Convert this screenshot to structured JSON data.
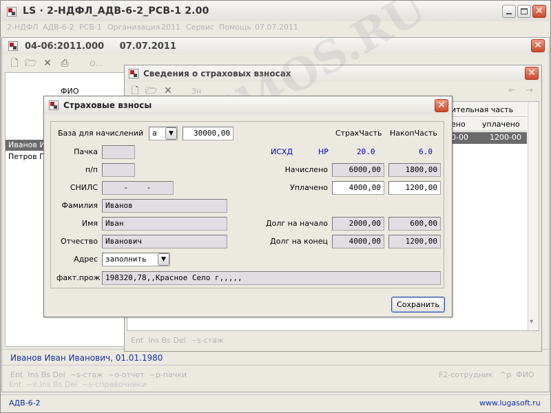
{
  "app": {
    "title": "LS · 2-НДФЛ_АДВ-6-2_РСВ-1  2.00",
    "menu": [
      "2-НДФЛ",
      "АДВ-6-2",
      "РСВ-1",
      "Организация",
      "2011",
      "Сервис",
      "Помощь",
      "07.07.2011"
    ]
  },
  "doc_window": {
    "title": "04-06:2011.000     07.07.2011",
    "toolbar_extra": "О...",
    "list_header": "ФИО",
    "rows": [
      "Иванов И",
      "Петров П"
    ],
    "footer_person": "Иванов Иван Иванович, 01.01.1980",
    "hotkeys_left": "Ent  Ins Bs Del  ~s-стаж  ~o-отчет  ~p-пачки",
    "hotkeys_right": "F2-сотрудник   ^p  ФИО",
    "ghost_hotkeys": "Ent  ~e.Ins Bs Del  ~s-справочники"
  },
  "ins_window": {
    "title": "Сведения о страховых взносах",
    "toolbar_extra": "Зн",
    "nav_back": "←",
    "nav_forward": "→",
    "col_group_header": "ительная часть",
    "col_headers": [
      "ено",
      "уплачено"
    ],
    "selected_row": [
      "0-00",
      "1200-00"
    ],
    "hotkeys": "Ent  Ins Bs Del  ~s-стаж"
  },
  "dialog": {
    "title": "Страховые взносы",
    "base_label": "База для начислений",
    "base_letter": "а",
    "base_value": "30000,00",
    "col_strah": "СтрахЧасть",
    "col_nakop": "НакопЧасть",
    "isxd_label": "ИСХД",
    "hr_label": "НР",
    "rate_strah": "20.0",
    "rate_nakop": "6.0",
    "pachka_label": "Пачка",
    "pachka_value": "",
    "pn_label": "п/п",
    "pn_value": "",
    "snils_label": "СНИЛС",
    "snils_value": "    -    -",
    "surname_label": "Фамилия",
    "surname_value": "Иванов",
    "name_label": "Имя",
    "name_value": "Иван",
    "patronymic_label": "Отчество",
    "patronymic_value": "Иванович",
    "address_label": "Адрес",
    "address_value": "заполнить",
    "fact_label": "факт.прож",
    "fact_value": "198320,78,,Красное Село г,,,,,",
    "accrued_label": "Начислено",
    "accrued_strah": "6000,00",
    "accrued_nakop": "1800,00",
    "paid_label": "Уплачено",
    "paid_strah": "4000,00",
    "paid_nakop": "1200,00",
    "debt_start_label": "Долг на начало",
    "debt_start_strah": "2000,00",
    "debt_start_nakop": "600,00",
    "debt_end_label": "Долг на конец",
    "debt_end_strah": "4000,00",
    "debt_end_nakop": "1200,00",
    "save_label": "Сохранить"
  },
  "status": {
    "left": "АДВ-6-2",
    "right": "www.lugasoft.ru"
  },
  "watermark": "All4OS.RU",
  "colors": {
    "accent_blue": "#0000cc",
    "selection": "#6b6b6b",
    "title_text": "#333333",
    "panel": "#ece9e1"
  }
}
